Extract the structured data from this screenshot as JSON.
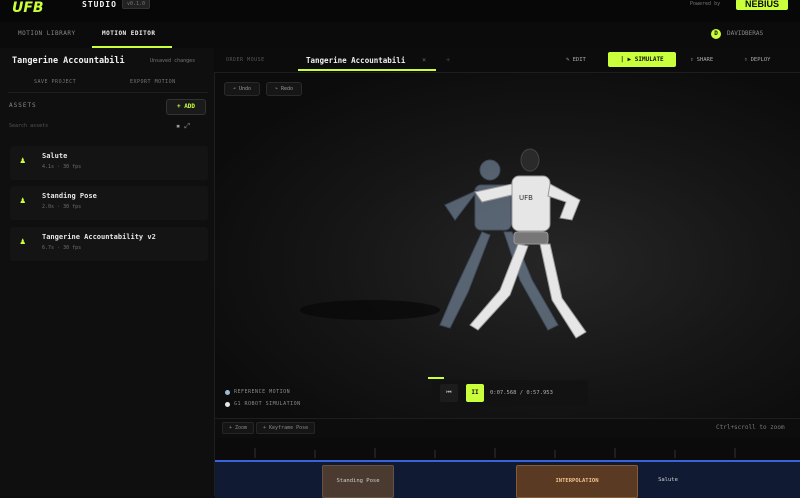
{
  "header": {
    "studio": "STUDIO",
    "version": "v0.1.0",
    "powered_by": "Powered by",
    "partner": "NEBIUS"
  },
  "nav": {
    "tabs": [
      "MOTION LIBRARY",
      "MOTION EDITOR"
    ],
    "user": "DAVIDBERAS",
    "user_initial": "D"
  },
  "sidebar": {
    "project_title": "Tangerine Accountabili",
    "unsaved": "Unsaved changes",
    "buttons": [
      "SAVE PROJECT",
      "EXPORT MOTION"
    ],
    "assets_label": "ASSETS",
    "add_label": "+ ADD",
    "search_placeholder": "Search assets",
    "assets": [
      {
        "name": "Salute",
        "meta": "4.1s · 30 fps"
      },
      {
        "name": "Standing Pose",
        "meta": "2.0s · 30 fps"
      },
      {
        "name": "Tangerine Accountability v2",
        "meta": "6.7s · 30 fps"
      }
    ]
  },
  "editor": {
    "tabs": [
      "ORDER MOUSE",
      "Tangerine Accountabili"
    ],
    "actions": {
      "edit": "EDIT",
      "simulate": "SIMULATE",
      "share": "SHARE",
      "deploy": "DEPLOY"
    },
    "undo": "Undo",
    "redo": "Redo",
    "legend": [
      "REFERENCE MOTION",
      "G1 ROBOT SIMULATION"
    ],
    "player": {
      "rewind": "⏮",
      "pause": "II",
      "time": "0:07.568 / 0:57.953"
    }
  },
  "timeline": {
    "buttons": [
      "+ Zoom",
      "+ Keyframe Pose"
    ],
    "hint": "Ctrl+scroll to zoom",
    "clips": [
      "Standing Pose",
      "INTERPOLATION",
      "Salute"
    ]
  },
  "colors": {
    "accent": "#c9ff3b",
    "track": "#3b62d9",
    "interp": "#5a3a22"
  }
}
